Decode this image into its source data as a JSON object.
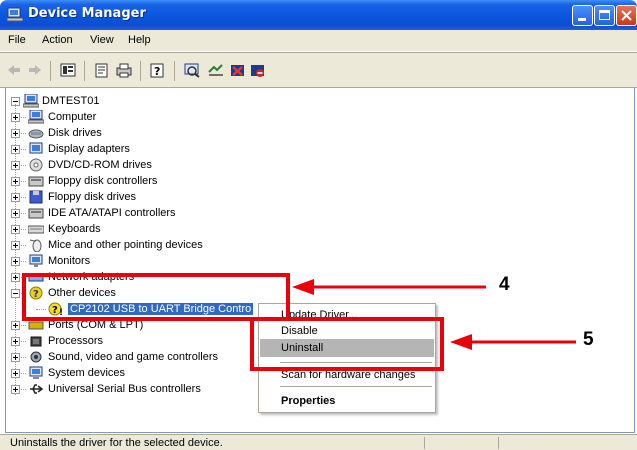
{
  "window": {
    "title": "Device Manager",
    "minimize_label": "_",
    "maximize_label": "□",
    "close_label": "X"
  },
  "menu": {
    "items": [
      {
        "label": "File"
      },
      {
        "label": "Action"
      },
      {
        "label": "View"
      },
      {
        "label": "Help"
      }
    ]
  },
  "toolbar": {
    "buttons": [
      "back-icon",
      "forward-icon",
      "properties-view-icon",
      "properties-icon",
      "print-icon",
      "help-icon",
      "scan-hardware-icon",
      "update-driver-icon",
      "disable-icon",
      "uninstall-icon"
    ]
  },
  "tree": {
    "root": "DMTEST01",
    "items": [
      {
        "label": "Computer",
        "icon": "computer-icon"
      },
      {
        "label": "Disk drives",
        "icon": "disk-drive-icon"
      },
      {
        "label": "Display adapters",
        "icon": "display-adapter-icon"
      },
      {
        "label": "DVD/CD-ROM drives",
        "icon": "dvd-icon"
      },
      {
        "label": "Floppy disk controllers",
        "icon": "controller-icon"
      },
      {
        "label": "Floppy disk drives",
        "icon": "floppy-icon"
      },
      {
        "label": "IDE ATA/ATAPI controllers",
        "icon": "ide-controller-icon"
      },
      {
        "label": "Keyboards",
        "icon": "keyboard-icon"
      },
      {
        "label": "Mice and other pointing devices",
        "icon": "mouse-icon"
      },
      {
        "label": "Monitors",
        "icon": "monitor-icon"
      },
      {
        "label": "Network adapters",
        "icon": "network-adapter-icon"
      },
      {
        "label": "Other devices",
        "icon": "unknown-device-icon"
      },
      {
        "label": "CP2102 USB to UART Bridge Contro",
        "icon": "warning-device-icon"
      },
      {
        "label": "Ports (COM & LPT)",
        "icon": "port-icon"
      },
      {
        "label": "Processors",
        "icon": "processor-icon"
      },
      {
        "label": "Sound, video and game controllers",
        "icon": "sound-icon"
      },
      {
        "label": "System devices",
        "icon": "system-device-icon"
      },
      {
        "label": "Universal Serial Bus controllers",
        "icon": "usb-icon"
      }
    ]
  },
  "context_menu": {
    "items": [
      {
        "label": "Update Driver..."
      },
      {
        "label": "Disable"
      },
      {
        "label": "Uninstall"
      },
      {
        "label": "Scan for hardware changes"
      },
      {
        "label": "Properties"
      }
    ]
  },
  "status": {
    "text": "Uninstalls the driver for the selected device."
  },
  "annotations": {
    "step_a": "4",
    "step_b": "5",
    "color": "#e8000b"
  },
  "colors": {
    "titlebar": "#0a55db",
    "selection": "#316ac5",
    "chrome": "#ece9d8"
  }
}
